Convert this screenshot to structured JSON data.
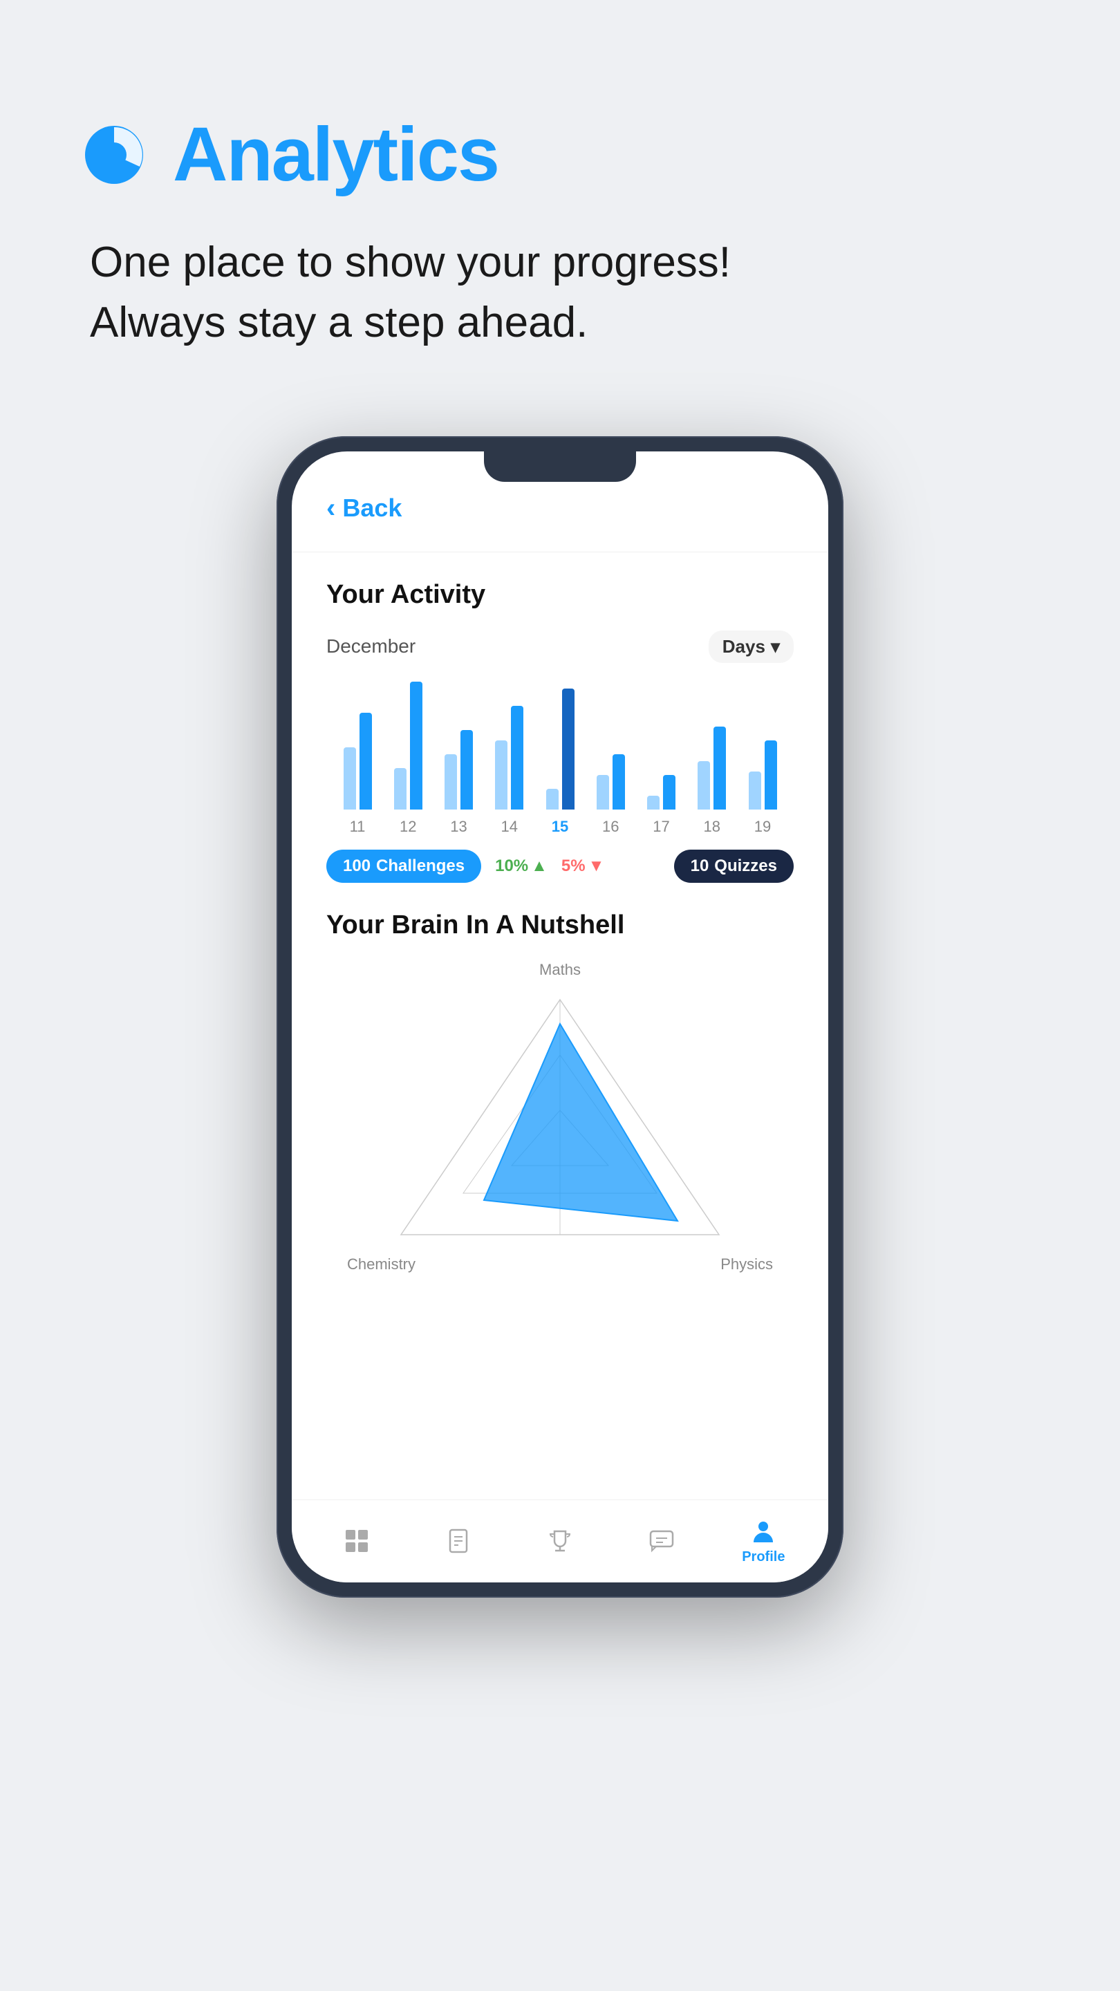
{
  "header": {
    "title": "Analytics",
    "subtitle_line1": "One place to show your progress!",
    "subtitle_line2": "Always stay a step ahead."
  },
  "phone": {
    "back_label": "Back",
    "activity": {
      "title": "Your Activity",
      "month": "December",
      "period": "Days",
      "bars": [
        {
          "day": "11",
          "h1": 90,
          "h2": 140,
          "highlight": false
        },
        {
          "day": "12",
          "h1": 60,
          "h2": 180,
          "highlight": false
        },
        {
          "day": "13",
          "h1": 80,
          "h2": 110,
          "highlight": false
        },
        {
          "day": "14",
          "h1": 100,
          "h2": 150,
          "highlight": false
        },
        {
          "day": "15",
          "h1": 30,
          "h2": 170,
          "highlight": true
        },
        {
          "day": "16",
          "h1": 50,
          "h2": 80,
          "highlight": false
        },
        {
          "day": "17",
          "h1": 20,
          "h2": 50,
          "highlight": false
        },
        {
          "day": "18",
          "h1": 70,
          "h2": 120,
          "highlight": false
        },
        {
          "day": "19",
          "h1": 55,
          "h2": 100,
          "highlight": false
        }
      ],
      "challenges_count": "100",
      "challenges_label": "Challenges",
      "percent_up": "10%",
      "percent_down": "5%",
      "quizzes_count": "10",
      "quizzes_label": "Quizzes"
    },
    "brain": {
      "title": "Your Brain In A Nutshell",
      "label_top": "Maths",
      "label_bottom_left": "Chemistry",
      "label_bottom_right": "Physics"
    },
    "nav": {
      "items": [
        {
          "icon": "grid",
          "label": "",
          "active": false
        },
        {
          "icon": "book",
          "label": "",
          "active": false
        },
        {
          "icon": "trophy",
          "label": "",
          "active": false
        },
        {
          "icon": "chat",
          "label": "",
          "active": false
        },
        {
          "icon": "person",
          "label": "Profile",
          "active": true
        }
      ]
    }
  }
}
